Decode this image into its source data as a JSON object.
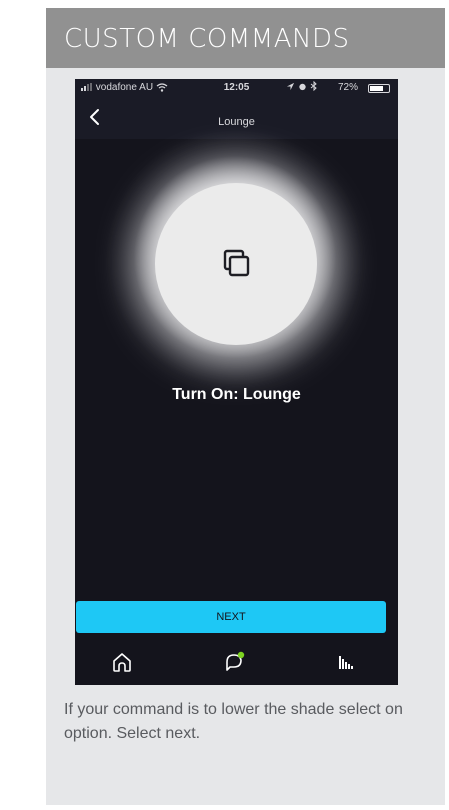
{
  "card": {
    "title": "CUSTOM COMMANDS",
    "caption": "If your command is to lower the shade select on option. Select next."
  },
  "phone": {
    "status_bar": {
      "carrier": "vodafone AU",
      "time": "12:05",
      "battery": "72%",
      "battery_level": 0.72
    },
    "nav": {
      "title": "Lounge",
      "back_icon": "chevron-left-icon"
    },
    "scene": {
      "icon": "scene-squares-icon",
      "label": "Turn On: Lounge"
    },
    "next_label": "NEXT",
    "tabs": [
      {
        "name": "home",
        "icon": "home-icon"
      },
      {
        "name": "chat",
        "icon": "chat-bubble-icon",
        "badge_color": "#7ed321"
      },
      {
        "name": "stats",
        "icon": "stats-icon"
      }
    ],
    "accent_color": "#1ec8f5"
  }
}
